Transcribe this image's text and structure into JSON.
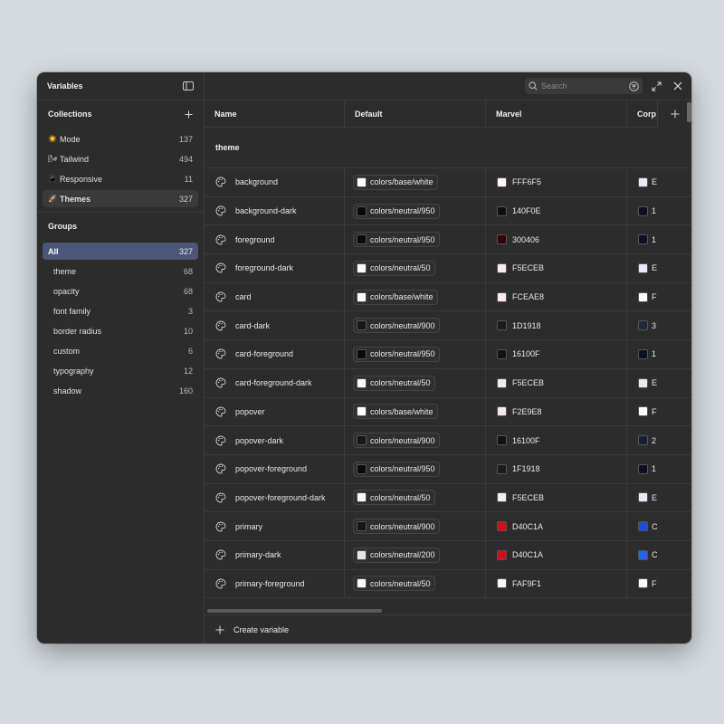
{
  "sidebar": {
    "title": "Variables",
    "collections_title": "Collections",
    "collections": [
      {
        "emoji": "☀️",
        "label": "Mode",
        "count": "137",
        "active": false
      },
      {
        "emoji": "🌬",
        "label": "Tailwind",
        "count": "494",
        "active": false
      },
      {
        "emoji": "📱",
        "label": "Responsive",
        "count": "11",
        "active": false
      },
      {
        "emoji": "🚀",
        "label": "Themes",
        "count": "327",
        "active": true
      }
    ],
    "groups_title": "Groups",
    "groups": [
      {
        "label": "All",
        "count": "327"
      },
      {
        "label": "theme",
        "count": "68"
      },
      {
        "label": "opacity",
        "count": "68"
      },
      {
        "label": "font family",
        "count": "3"
      },
      {
        "label": "border radius",
        "count": "10"
      },
      {
        "label": "custom",
        "count": "6"
      },
      {
        "label": "typography",
        "count": "12"
      },
      {
        "label": "shadow",
        "count": "160"
      }
    ]
  },
  "toolbar": {
    "search_placeholder": "Search"
  },
  "table": {
    "columns": [
      "Name",
      "Default",
      "Marvel",
      "Corp"
    ],
    "group_label": "theme",
    "rows": [
      {
        "name": "background",
        "default": "colors/base/white",
        "default_color": "#ffffff",
        "marvel": "FFF6F5",
        "marvel_color": "#fff6f5",
        "corp": "E",
        "corp_color": "#e6ebf5"
      },
      {
        "name": "background-dark",
        "default": "colors/neutral/950",
        "default_color": "#0a0a0a",
        "marvel": "140F0E",
        "marvel_color": "#140f0e",
        "corp": "1",
        "corp_color": "#0b1120"
      },
      {
        "name": "foreground",
        "default": "colors/neutral/950",
        "default_color": "#0a0a0a",
        "marvel": "300406",
        "marvel_color": "#300406",
        "corp": "1",
        "corp_color": "#0b1120"
      },
      {
        "name": "foreground-dark",
        "default": "colors/neutral/50",
        "default_color": "#fafafa",
        "marvel": "F5ECEB",
        "marvel_color": "#f5eceb",
        "corp": "E",
        "corp_color": "#e6ebf5"
      },
      {
        "name": "card",
        "default": "colors/base/white",
        "default_color": "#ffffff",
        "marvel": "FCEAE8",
        "marvel_color": "#fceae8",
        "corp": "F",
        "corp_color": "#ffffff"
      },
      {
        "name": "card-dark",
        "default": "colors/neutral/900",
        "default_color": "#171717",
        "marvel": "1D1918",
        "marvel_color": "#1d1918",
        "corp": "3",
        "corp_color": "#1f2937"
      },
      {
        "name": "card-foreground",
        "default": "colors/neutral/950",
        "default_color": "#0a0a0a",
        "marvel": "16100F",
        "marvel_color": "#16100f",
        "corp": "1",
        "corp_color": "#0b1120"
      },
      {
        "name": "card-foreground-dark",
        "default": "colors/neutral/50",
        "default_color": "#fafafa",
        "marvel": "F5ECEB",
        "marvel_color": "#f5eceb",
        "corp": "E",
        "corp_color": "#e6ebf5"
      },
      {
        "name": "popover",
        "default": "colors/base/white",
        "default_color": "#ffffff",
        "marvel": "F2E9E8",
        "marvel_color": "#f2e9e8",
        "corp": "F",
        "corp_color": "#ffffff"
      },
      {
        "name": "popover-dark",
        "default": "colors/neutral/900",
        "default_color": "#171717",
        "marvel": "16100F",
        "marvel_color": "#16100f",
        "corp": "2",
        "corp_color": "#172033"
      },
      {
        "name": "popover-foreground",
        "default": "colors/neutral/950",
        "default_color": "#0a0a0a",
        "marvel": "1F1918",
        "marvel_color": "#1f1918",
        "corp": "1",
        "corp_color": "#0b1120"
      },
      {
        "name": "popover-foreground-dark",
        "default": "colors/neutral/50",
        "default_color": "#fafafa",
        "marvel": "F5ECEB",
        "marvel_color": "#f5eceb",
        "corp": "E",
        "corp_color": "#e6ebf5"
      },
      {
        "name": "primary",
        "default": "colors/neutral/900",
        "default_color": "#171717",
        "marvel": "D40C1A",
        "marvel_color": "#d40c1a",
        "corp": "C",
        "corp_color": "#1d4ed8"
      },
      {
        "name": "primary-dark",
        "default": "colors/neutral/200",
        "default_color": "#e5e5e5",
        "marvel": "D40C1A",
        "marvel_color": "#d40c1a",
        "corp": "C",
        "corp_color": "#2563eb"
      },
      {
        "name": "primary-foreground",
        "default": "colors/neutral/50",
        "default_color": "#fafafa",
        "marvel": "FAF9F1",
        "marvel_color": "#faf9f1",
        "corp": "F",
        "corp_color": "#ffffff"
      }
    ]
  },
  "footer": {
    "create_label": "Create variable"
  },
  "icons": {
    "sidebar_toggle": "panel-icon",
    "add": "plus-icon",
    "search": "search-icon",
    "filter": "filter-icon",
    "expand": "expand-icon",
    "close": "close-icon",
    "variable": "palette-icon"
  }
}
